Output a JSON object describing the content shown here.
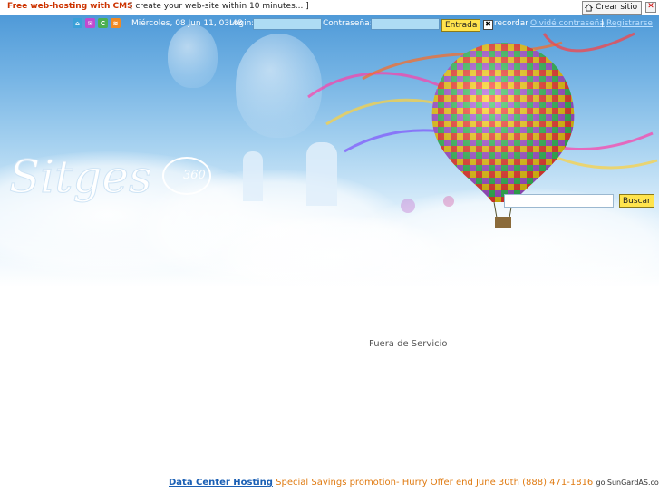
{
  "topbar": {
    "promo_link": "Free web-hosting with CMS",
    "tagline": "[ create your web-site within 10 minutes... ]",
    "create_site_label": "Crear sitio",
    "close_glyph": "✕"
  },
  "header": {
    "quick_icons": [
      {
        "name": "home-icon",
        "glyph": "⌂",
        "color": "#3aa0d8"
      },
      {
        "name": "mail-icon",
        "glyph": "✉",
        "color": "#c04ad0"
      },
      {
        "name": "copyright-icon",
        "glyph": "C",
        "color": "#4caf50"
      },
      {
        "name": "rss-icon",
        "glyph": "≋",
        "color": "#f08a24"
      }
    ],
    "date": "Miércoles, 08 Jun 11, 03:48",
    "login_label": "Login:",
    "password_label": "Contraseña:",
    "login_value": "",
    "password_value": "",
    "submit_label": "Entrada",
    "remember_checked_glyph": "✖",
    "remember_label": "recordar",
    "forgot_link": "Olvidé contraseña",
    "separator": "|",
    "register_link": "Registrarse"
  },
  "brand": {
    "logo_text": "Sitges",
    "logo_number": "360"
  },
  "search": {
    "value": "",
    "button_label": "Buscar"
  },
  "main": {
    "status_message": "Fuera de Servicio"
  },
  "footer_ad": {
    "link_label": "Data Center Hosting",
    "text": " Special Savings promotion- Hurry Offer end June 30th (888) 471-1816 ",
    "domain": "go.SunGardAS.com"
  },
  "colors": {
    "sky_top": "#4f9ad8",
    "button_yellow": "#ffe44d",
    "ad_link_blue": "#1a5fb4",
    "ad_text_orange": "#e07b12",
    "promo_red": "#cc3300"
  }
}
